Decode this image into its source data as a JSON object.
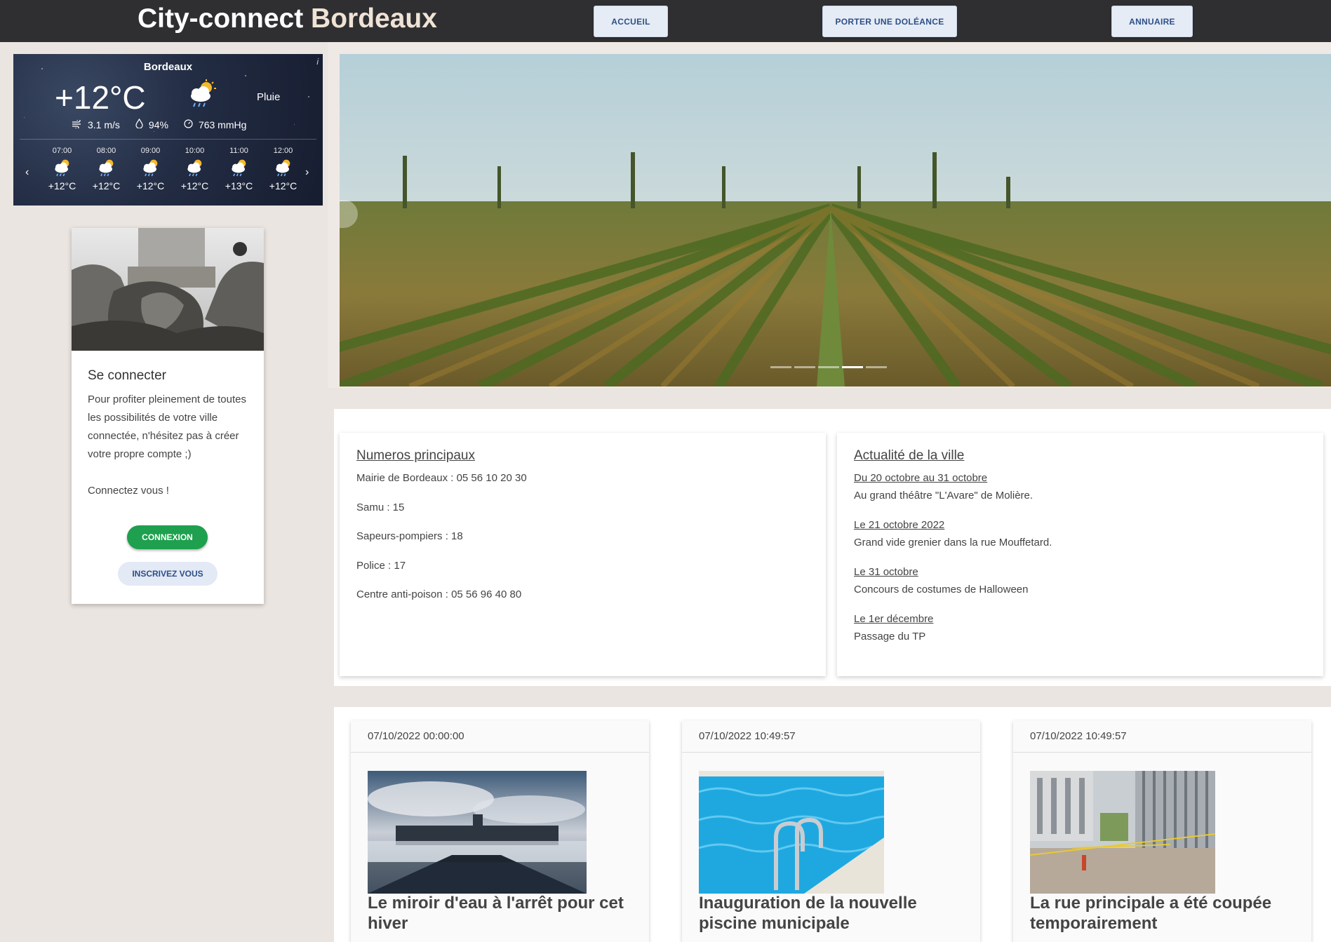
{
  "header": {
    "brand_part1": "City-connect",
    "brand_part2": "Bordeaux",
    "nav": [
      {
        "label": "ACCUEIL"
      },
      {
        "label": "PORTER UNE DOLÉANCE"
      },
      {
        "label": "ANNUAIRE"
      }
    ]
  },
  "weather": {
    "city": "Bordeaux",
    "info_glyph": "i",
    "temperature": "+12°C",
    "condition": "Pluie",
    "wind": "3.1 m/s",
    "humidity": "94%",
    "pressure": "763 mmHg",
    "prev_glyph": "‹",
    "next_glyph": "›",
    "hourly": [
      {
        "time": "07:00",
        "temp": "+12°C"
      },
      {
        "time": "08:00",
        "temp": "+12°C"
      },
      {
        "time": "09:00",
        "temp": "+12°C"
      },
      {
        "time": "10:00",
        "temp": "+12°C"
      },
      {
        "time": "11:00",
        "temp": "+13°C"
      },
      {
        "time": "12:00",
        "temp": "+12°C"
      }
    ]
  },
  "login": {
    "title": "Se connecter",
    "text": "Pour profiter pleinement de toutes les possibilités de votre ville connectée, n'hésitez pas à créer votre propre compte ;)",
    "cta": "Connectez vous !",
    "login_button": "CONNEXION",
    "register_button": "INSCRIVEZ VOUS"
  },
  "carousel": {
    "slide_count": 5,
    "active_index": 3
  },
  "numbers": {
    "title": "Numeros principaux",
    "items": [
      "Mairie de Bordeaux : 05 56 10 20 30",
      "Samu : 15",
      "Sapeurs-pompiers : 18",
      "Police : 17",
      "Centre anti-poison : 05 56 96 40 80"
    ]
  },
  "news": {
    "title": "Actualité de la ville",
    "items": [
      {
        "date": "Du 20 octobre au 31 octobre",
        "text": "Au grand théâtre \"L'Avare\" de Molière."
      },
      {
        "date": "Le 21 octobre 2022",
        "text": "Grand vide grenier dans la rue Mouffetard."
      },
      {
        "date": "Le 31 octobre",
        "text": "Concours de costumes de Halloween"
      },
      {
        "date": "Le 1er décembre",
        "text": "Passage du TP"
      }
    ]
  },
  "articles": [
    {
      "date": "07/10/2022 00:00:00",
      "title": "Le miroir d'eau à l'arrêt pour cet hiver",
      "image": "miroir-d-eau-photo"
    },
    {
      "date": "07/10/2022 10:49:57",
      "title": "Inauguration de la nouvelle piscine municipale",
      "image": "swimming-pool-photo"
    },
    {
      "date": "07/10/2022 10:49:57",
      "title": "La rue principale a été coupée temporairement",
      "image": "closed-street-photo"
    }
  ],
  "colors": {
    "header_bg": "#2f2e30",
    "page_bg": "#ebe5e1",
    "accent_green": "#1ea04e",
    "nav_button_bg": "#e6ecf5",
    "nav_button_text": "#2d4f88"
  }
}
